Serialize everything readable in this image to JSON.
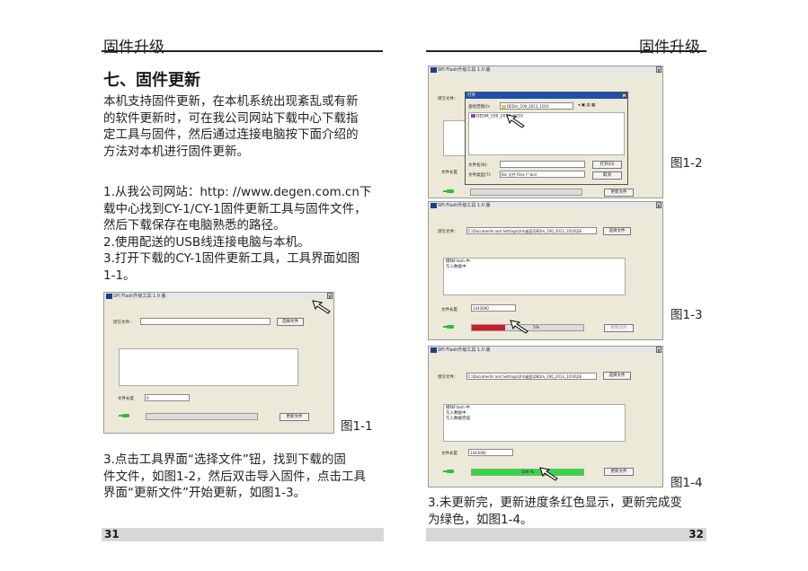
{
  "left_page": {
    "header": "固件升级",
    "section_title": "七、固件更新",
    "intro_lines": [
      "本机支持固件更新，在本机系统出现紊乱或有新",
      "的软件更新时，可在我公司网站下载中心下载指",
      "定工具与固件，然后通过连接电脑按下面介绍的",
      "方法对本机进行固件更新。"
    ],
    "steps_lines": [
      "1.从我公司网站：http: //www.degen.com.cn下",
      "载中心找到CY-1/CY-1固件更新工具与固件文件，",
      "然后下载保存在电脑熟悉的路径。",
      "2.使用配送的USB线连接电脑与本机。",
      "3.打开下载的CY-1固件更新工具，工具界面如图",
      "1-1。"
    ],
    "step3_lines": [
      "3.点击工具界面“选择文件”钮，找到下载的固",
      "件文件，如图1-2，然后双击导入固件，点击工具",
      "界面“更新文件”开始更新，如图1-3。"
    ],
    "page_number": "31",
    "figure_label": "图1-1"
  },
  "right_page": {
    "header": "固件升级",
    "figure_labels": [
      "图1-2",
      "图1-3",
      "图1-4"
    ],
    "caption_lines": [
      "3.未更新完，更新进度条红色显示，更新完成变",
      "为绿色，如图1-4。"
    ],
    "page_number": "32"
  },
  "tool_window": {
    "title": "SPI Flash升级工具 1.0 版",
    "close_glyph": "x",
    "file_label": "烧写文件：",
    "select_button": "选择文件",
    "length_label": "文件长度",
    "update_button": "更新文件",
    "file_path": "C:\\Documents and Settings\\zhl\\桌面\\DEDm_100_2013_1010\\DE",
    "file_length_fig1": "0",
    "file_length": "1443090",
    "log_fig3": [
      "擦除Flash 中.",
      "写入数据中."
    ],
    "log_fig4": [
      "擦除Flash 中.",
      "写入数据中.",
      "写入数据完成."
    ],
    "progress_fig3_text": "5%",
    "progress_fig3_value": 0.3,
    "progress_fig4_text": "100 %",
    "progress_fig4_value": 1.0,
    "colors": {
      "progress_red": "#d0192b",
      "progress_green": "#27e03a"
    }
  },
  "open_dialog": {
    "title": "打开",
    "close_glyph": "x",
    "lookin_label": "查找范围(I):",
    "lookin_value": "DEDm_100_2013_1010",
    "file_item": "DEDM_100_2013_1010",
    "filename_label": "文件名(N):",
    "filetype_label": "文件类型(T):",
    "filetype_value": "Bin 文件 Files (*.bin)",
    "open_button": "打开(O)",
    "cancel_button": "取消"
  }
}
